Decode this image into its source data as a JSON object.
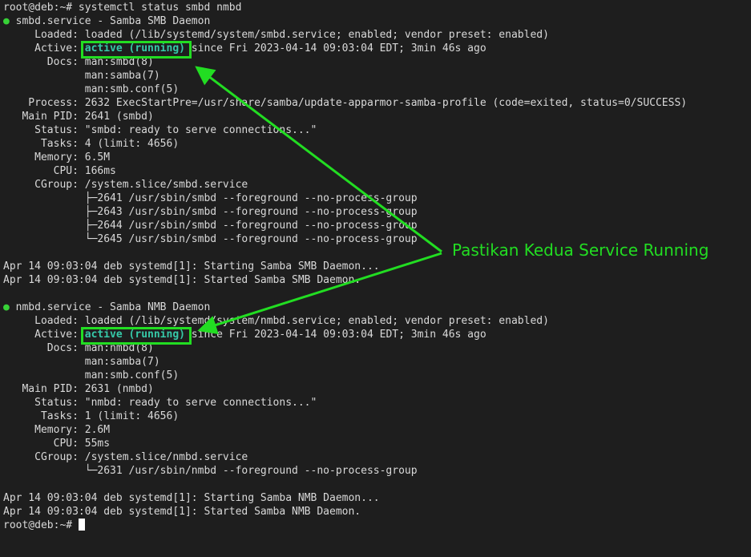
{
  "terminal": {
    "prompt_cmd": "root@deb:~# systemctl status smbd nmbd",
    "smbd": {
      "dot": "●",
      "header": " smbd.service - Samba SMB Daemon",
      "loaded": "     Loaded: loaded (/lib/systemd/system/smbd.service; enabled; vendor preset: enabled)",
      "active_label": "     Active: ",
      "active_state": "active (running)",
      "active_rest": " since Fri 2023-04-14 09:03:04 EDT; 3min 46s ago",
      "docs1": "       Docs: man:smbd(8)",
      "docs2": "             man:samba(7)",
      "docs3": "             man:smb.conf(5)",
      "process": "    Process: 2632 ExecStartPre=/usr/share/samba/update-apparmor-samba-profile (code=exited, status=0/SUCCESS)",
      "mainpid": "   Main PID: 2641 (smbd)",
      "status": "     Status: \"smbd: ready to serve connections...\"",
      "tasks": "      Tasks: 4 (limit: 4656)",
      "memory": "     Memory: 6.5M",
      "cpu": "        CPU: 166ms",
      "cgroup": "     CGroup: /system.slice/smbd.service",
      "cg1": "             ├─2641 /usr/sbin/smbd --foreground --no-process-group",
      "cg2": "             ├─2643 /usr/sbin/smbd --foreground --no-process-group",
      "cg3": "             ├─2644 /usr/sbin/smbd --foreground --no-process-group",
      "cg4": "             └─2645 /usr/sbin/smbd --foreground --no-process-group",
      "log1": "Apr 14 09:03:04 deb systemd[1]: Starting Samba SMB Daemon...",
      "log2": "Apr 14 09:03:04 deb systemd[1]: Started Samba SMB Daemon."
    },
    "nmbd": {
      "dot": "●",
      "header": " nmbd.service - Samba NMB Daemon",
      "loaded": "     Loaded: loaded (/lib/systemd/system/nmbd.service; enabled; vendor preset: enabled)",
      "active_label": "     Active: ",
      "active_state": "active (running)",
      "active_rest": " since Fri 2023-04-14 09:03:04 EDT; 3min 46s ago",
      "docs1": "       Docs: man:nmbd(8)",
      "docs2": "             man:samba(7)",
      "docs3": "             man:smb.conf(5)",
      "mainpid": "   Main PID: 2631 (nmbd)",
      "status": "     Status: \"nmbd: ready to serve connections...\"",
      "tasks": "      Tasks: 1 (limit: 4656)",
      "memory": "     Memory: 2.6M",
      "cpu": "        CPU: 55ms",
      "cgroup": "     CGroup: /system.slice/nmbd.service",
      "cg1": "             └─2631 /usr/sbin/nmbd --foreground --no-process-group",
      "log1": "Apr 14 09:03:04 deb systemd[1]: Starting Samba NMB Daemon...",
      "log2": "Apr 14 09:03:04 deb systemd[1]: Started Samba NMB Daemon."
    },
    "final_prompt": "root@deb:~# "
  },
  "annotation": {
    "text": "Pastikan Kedua Service Running",
    "color": "#22dd22"
  }
}
